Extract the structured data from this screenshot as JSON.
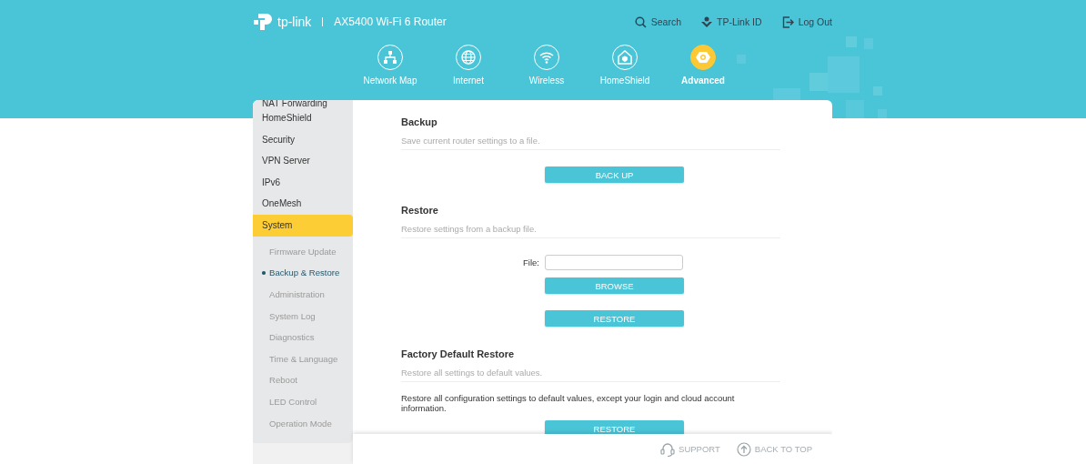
{
  "header": {
    "brand": "tp-link",
    "model": "AX5400 Wi-Fi 6 Router",
    "links": [
      {
        "label": "Search",
        "kind": "search"
      },
      {
        "label": "TP-Link ID",
        "kind": "id"
      },
      {
        "label": "Log Out",
        "kind": "logout"
      }
    ]
  },
  "nav": [
    {
      "label": "Network Map",
      "kind": "network",
      "selected": false
    },
    {
      "label": "Internet",
      "kind": "internet",
      "selected": false
    },
    {
      "label": "Wireless",
      "kind": "wireless",
      "selected": false
    },
    {
      "label": "HomeShield",
      "kind": "homeshield",
      "selected": false
    },
    {
      "label": "Advanced",
      "kind": "advanced",
      "selected": true
    }
  ],
  "sidebar": {
    "items": [
      {
        "label": "NAT Forwarding",
        "selected": false
      },
      {
        "label": "HomeShield",
        "selected": false
      },
      {
        "label": "Security",
        "selected": false
      },
      {
        "label": "VPN Server",
        "selected": false
      },
      {
        "label": "IPv6",
        "selected": false
      },
      {
        "label": "OneMesh",
        "selected": false
      },
      {
        "label": "System",
        "selected": true,
        "children": [
          {
            "label": "Firmware Update",
            "selected": false
          },
          {
            "label": "Backup & Restore",
            "selected": true
          },
          {
            "label": "Administration",
            "selected": false
          },
          {
            "label": "System Log",
            "selected": false
          },
          {
            "label": "Diagnostics",
            "selected": false
          },
          {
            "label": "Time & Language",
            "selected": false
          },
          {
            "label": "Reboot",
            "selected": false
          },
          {
            "label": "LED Control",
            "selected": false
          },
          {
            "label": "Operation Mode",
            "selected": false
          }
        ]
      }
    ]
  },
  "sections": [
    {
      "title": "Backup",
      "description": "Save current router settings to a file.",
      "content": [
        {
          "kind": "button",
          "label": "BACK UP"
        }
      ]
    },
    {
      "title": "Restore",
      "description": "Restore settings from a backup file.",
      "content": [
        {
          "kind": "file",
          "label": "File:"
        },
        {
          "kind": "button",
          "label": "BROWSE"
        },
        {
          "kind": "button",
          "label": "RESTORE"
        }
      ]
    },
    {
      "title": "Factory Default Restore",
      "description": "Restore all settings to default values.",
      "content": [
        {
          "kind": "text",
          "text": "Restore all configuration settings to default values, except your login and cloud account information."
        },
        {
          "kind": "button",
          "label": "RESTORE"
        }
      ]
    }
  ],
  "footer": {
    "links": [
      {
        "label": "SUPPORT",
        "kind": "support"
      },
      {
        "label": "BACK TO TOP",
        "kind": "top"
      }
    ]
  }
}
